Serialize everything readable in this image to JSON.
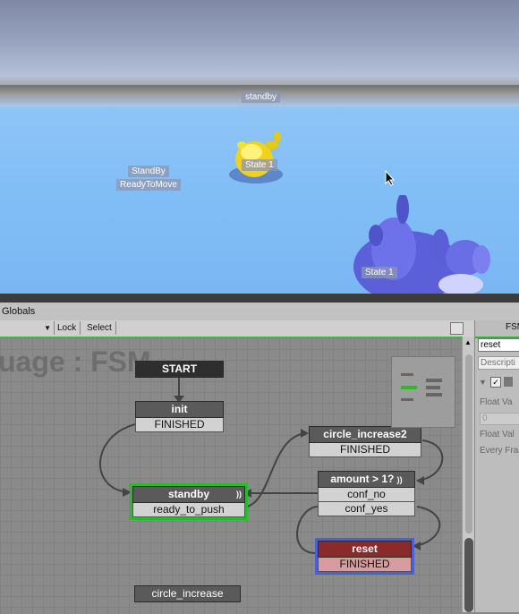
{
  "scene": {
    "labels": {
      "standby_top": "standby",
      "standby_left": "StandBy",
      "ready_to_move": "ReadyToMove",
      "state1_yellow": "State 1",
      "state1_blue": "State 1"
    }
  },
  "editor": {
    "globals_label": "Globals",
    "lock_label": "Lock",
    "select_label": "Select",
    "fsm_tab_partial": "FSM",
    "watermark": "uage : FSM"
  },
  "fsm": {
    "start_label": "START",
    "states": {
      "init": {
        "name": "init",
        "event": "FINISHED"
      },
      "circle_increase2": {
        "name": "circle_increase2",
        "event": "FINISHED"
      },
      "amount": {
        "name": "amount > 1?",
        "events": [
          "conf_no",
          "conf_yes"
        ]
      },
      "standby": {
        "name": "standby",
        "event": "ready_to_push"
      },
      "reset": {
        "name": "reset",
        "event": "FINISHED"
      },
      "circle_increase": {
        "name": "circle_increase"
      }
    }
  },
  "inspector": {
    "name_value": "reset",
    "description_placeholder": "Descripti",
    "rows": [
      "Float Va",
      "0",
      "Float Val",
      "Every Fra"
    ]
  },
  "colors": {
    "selected_state": "#2db82d",
    "reset_header": "#8b2a2a",
    "reset_border": "#4a60d8"
  }
}
